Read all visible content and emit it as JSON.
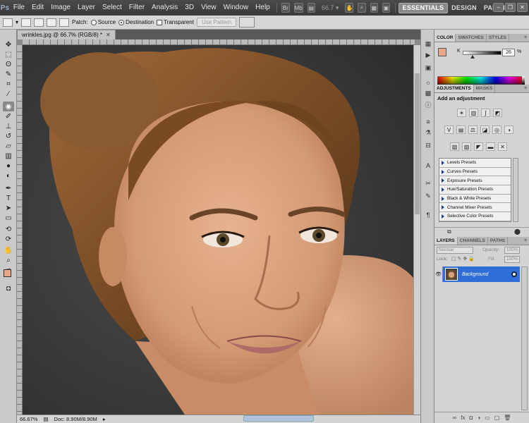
{
  "app": {
    "logo": "Ps"
  },
  "menu": {
    "items": [
      "File",
      "Edit",
      "Image",
      "Layer",
      "Select",
      "Filter",
      "Analysis",
      "3D",
      "View",
      "Window",
      "Help"
    ]
  },
  "zoom_control": {
    "value": "66.7"
  },
  "workspaces": {
    "essentials": "ESSENTIALS",
    "design": "DESIGN",
    "painting": "PAINTING",
    "more": "»"
  },
  "options_bar": {
    "patch_label": "Patch:",
    "source_label": "Source",
    "destination_label": "Destination",
    "transparent_label": "Transparent",
    "use_pattern_label": "Use Pattern",
    "selected_mode": "Destination"
  },
  "document": {
    "tab_title": "wrinkles.jpg @ 66.7% (RGB/8) *",
    "zoom_status": "66.67%",
    "doc_size": "Doc: 8.90M/8.90M"
  },
  "color_panel": {
    "tabs": [
      "COLOR",
      "SWATCHES",
      "STYLES"
    ],
    "channel_label": "K",
    "channel_value": "26",
    "channel_unit": "%",
    "foreground_color": "#e8a888",
    "background_color": "#ffffff"
  },
  "adjustments_panel": {
    "tabs": [
      "ADJUSTMENTS",
      "MASKS"
    ],
    "title": "Add an adjustment",
    "presets": [
      "Levels Presets",
      "Curves Presets",
      "Exposure Presets",
      "Hue/Saturation Presets",
      "Black & White Presets",
      "Channel Mixer Presets",
      "Selective Color Presets"
    ]
  },
  "layers_panel": {
    "tabs": [
      "LAYERS",
      "CHANNELS",
      "PATHS"
    ],
    "blend_mode": "Normal",
    "opacity_label": "Opacity:",
    "opacity_value": "100%",
    "lock_label": "Lock:",
    "fill_label": "Fill:",
    "fill_value": "100%",
    "layers": [
      {
        "name": "Background",
        "visible": true,
        "locked": true
      }
    ]
  },
  "icons": {
    "tools": [
      "move-tool-icon",
      "marquee-tool-icon",
      "lasso-tool-icon",
      "quick-selection-tool-icon",
      "crop-tool-icon",
      "eyedropper-tool-icon",
      "patch-tool-icon",
      "brush-tool-icon",
      "clone-stamp-tool-icon",
      "history-brush-tool-icon",
      "eraser-tool-icon",
      "gradient-tool-icon",
      "blur-tool-icon",
      "dodge-tool-icon",
      "pen-tool-icon",
      "type-tool-icon",
      "path-selection-tool-icon",
      "shape-tool-icon",
      "3d-rotate-tool-icon",
      "3d-orbit-tool-icon",
      "hand-tool-icon",
      "zoom-tool-icon"
    ]
  }
}
